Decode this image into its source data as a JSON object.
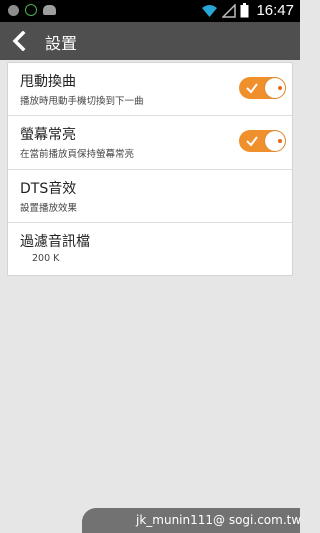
{
  "status_bar": {
    "time": "16:47",
    "icons": [
      "notification-icon",
      "battery-level-icon",
      "android-icon",
      "wifi-icon",
      "signal-icon",
      "battery-icon"
    ]
  },
  "action_bar": {
    "title": "設置",
    "back_icon": "chevron-left-icon"
  },
  "settings": [
    {
      "title": "甩動換曲",
      "subtitle": "播放時甩動手機切換到下一曲",
      "toggle": true
    },
    {
      "title": "螢幕常亮",
      "subtitle": "在當前播放頁保持螢幕常亮",
      "toggle": true
    },
    {
      "title": "DTS音效",
      "subtitle": "設置播放效果"
    },
    {
      "title": "過濾音訊檔",
      "subtitle": "200 K"
    }
  ],
  "colors": {
    "accent": "#f0902c",
    "action_bar": "#4f4f4f",
    "background": "#e6e6e6"
  },
  "watermark": "jk_munin111@ sogi.com.tw"
}
